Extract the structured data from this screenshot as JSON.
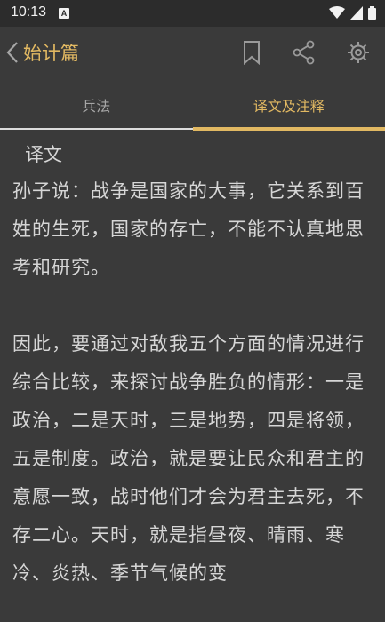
{
  "status_bar": {
    "time": "10:13",
    "notification_badge": "A"
  },
  "toolbar": {
    "title": "始计篇",
    "icons": [
      "back-chevron-icon",
      "bookmark-icon",
      "share-icon",
      "settings-gear-icon"
    ]
  },
  "tabs": [
    {
      "label": "兵法",
      "active": false
    },
    {
      "label": "译文及注释",
      "active": true
    }
  ],
  "content": {
    "heading": "译文",
    "paragraph1": "孙子说：战争是国家的大事，它关系到百姓的生死，国家的存亡，不能不认真地思考和研究。",
    "paragraph2": "因此，要通过对敌我五个方面的情况进行综合比较，来探讨战争胜负的情形：一是政治，二是天时，三是地势，四是将领，五是制度。政治，就是要让民众和君主的意愿一致，战时他们才会为君主去死，不存二心。天时，就是指昼夜、晴雨、寒冷、炎热、季节气候的变"
  },
  "colors": {
    "accent": "#e1b862",
    "background": "#3a3a3a",
    "text": "#d6d6d6"
  }
}
